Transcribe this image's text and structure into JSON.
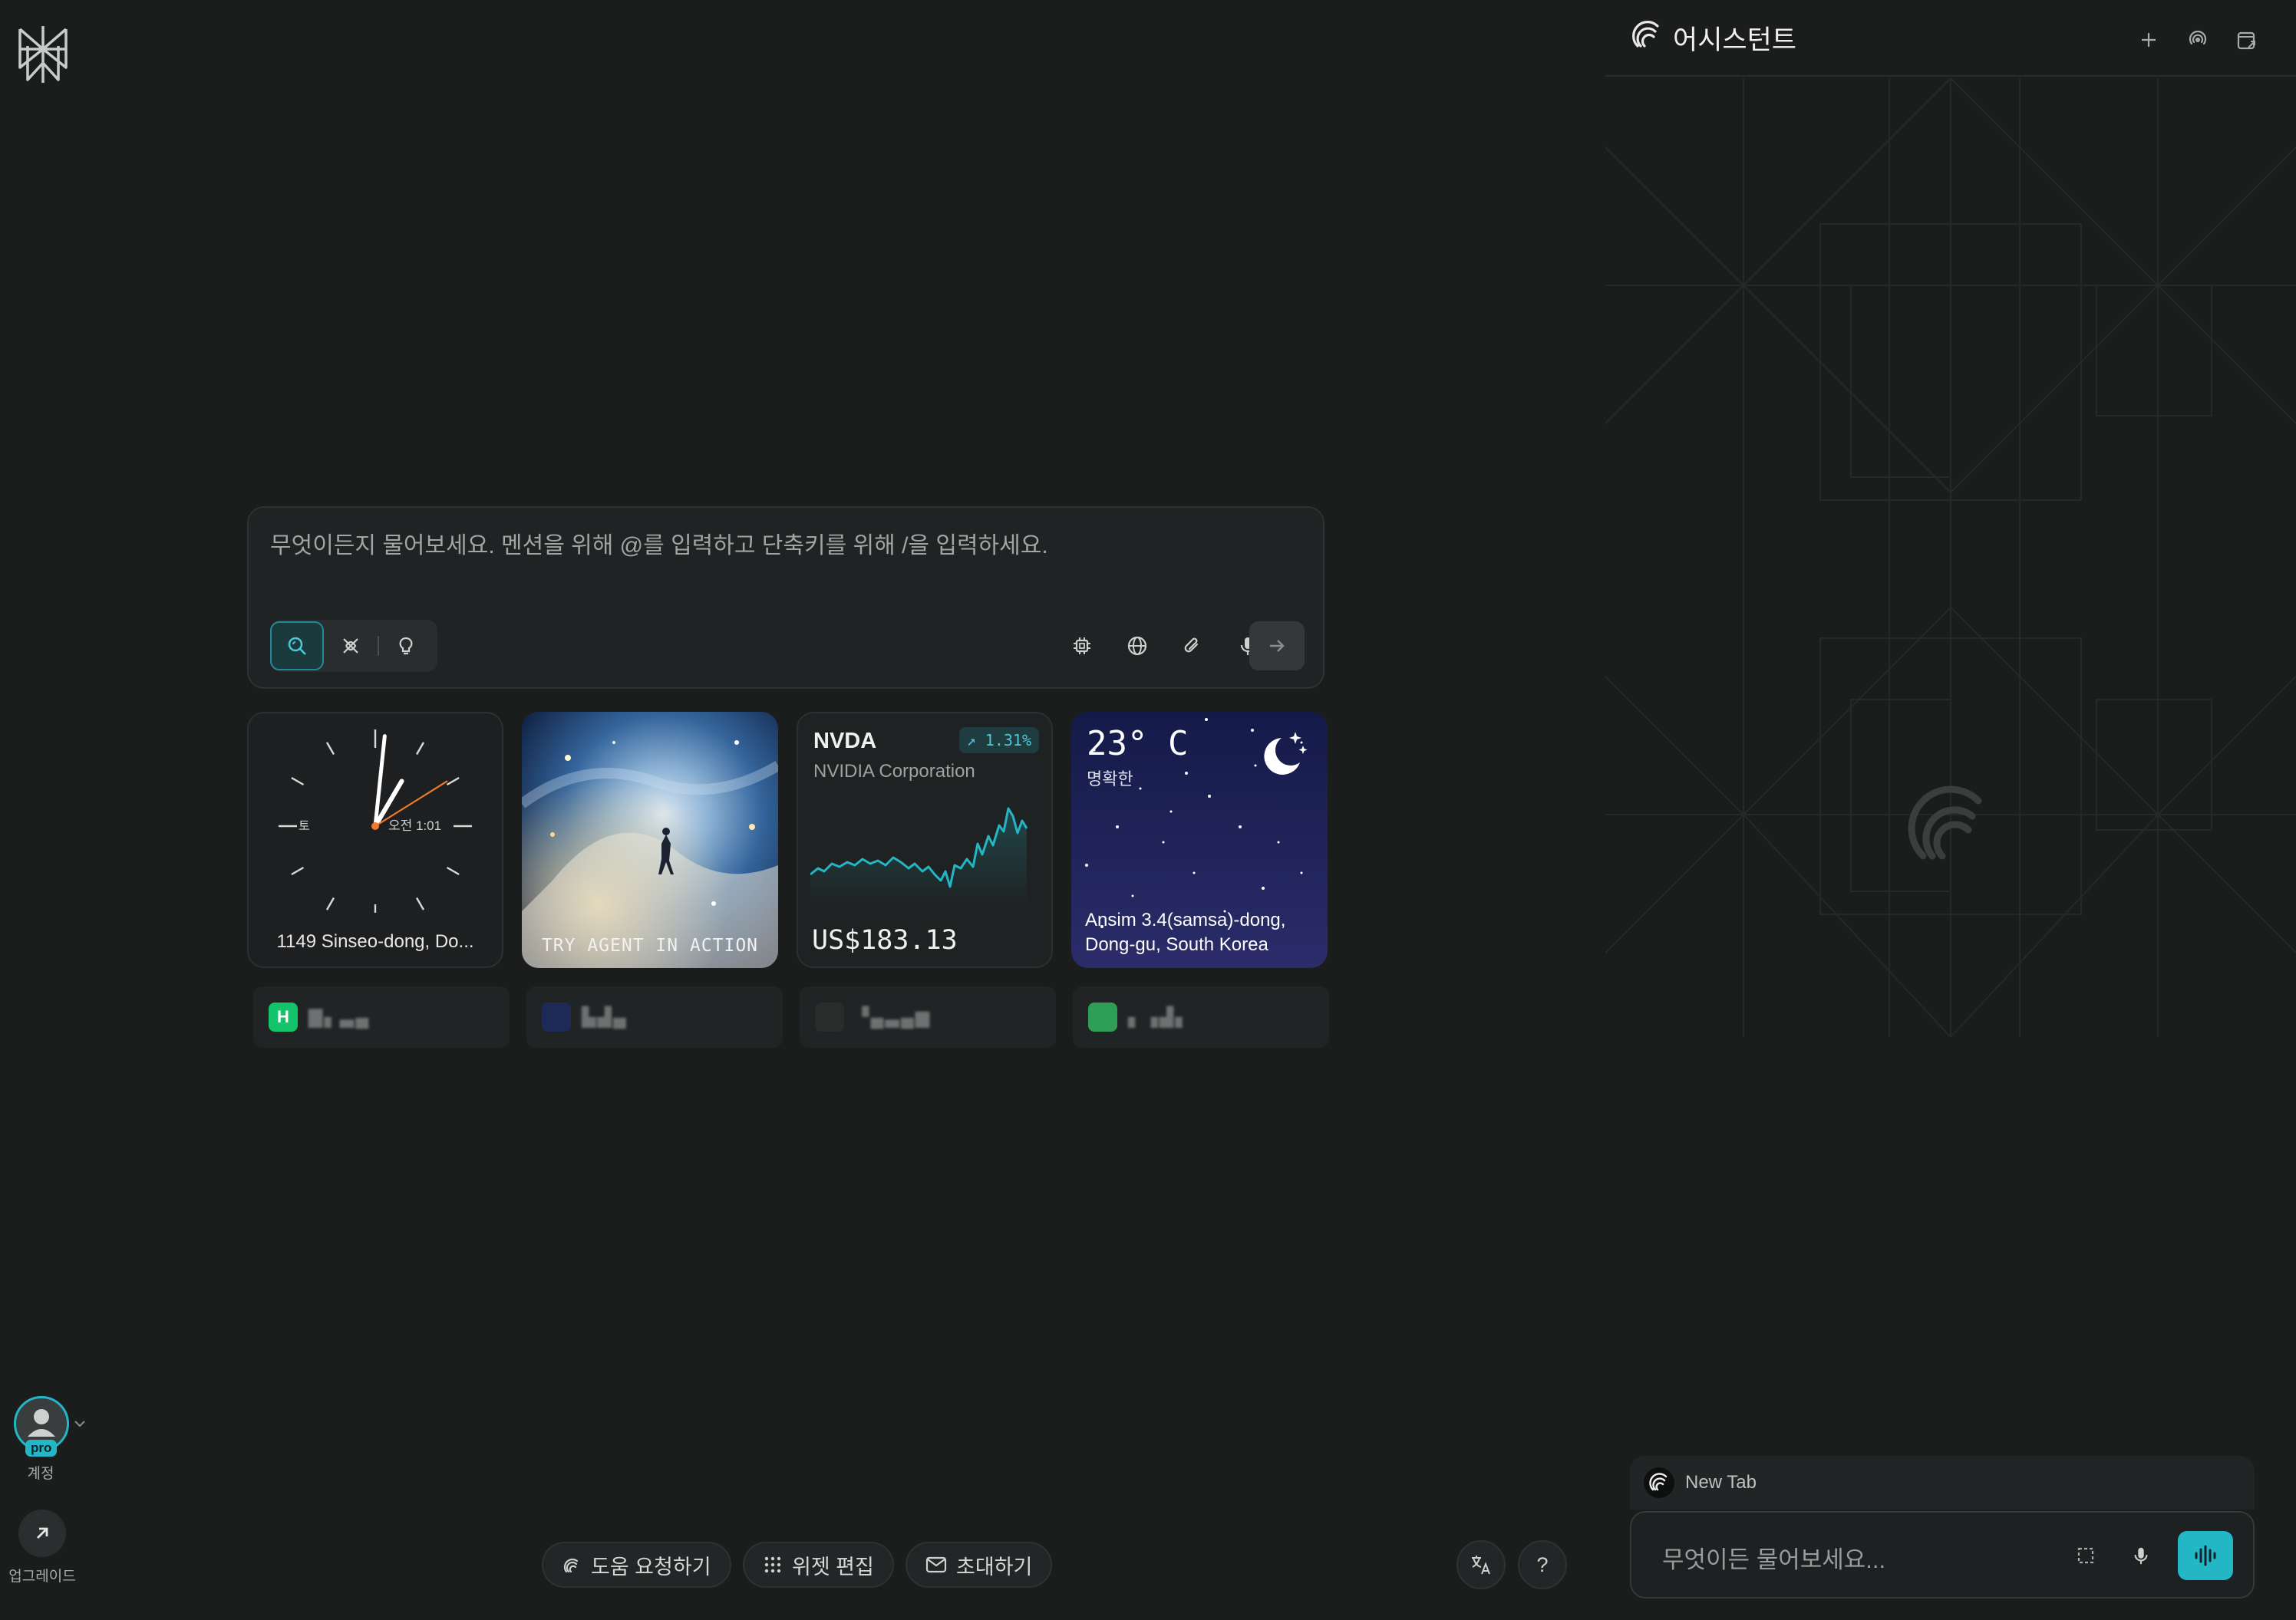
{
  "prompt": {
    "placeholder": "무엇이든지 물어보세요. 멘션을 위해 @를 입력하고 단축키를 위해 /을 입력하세요.",
    "modes": [
      "search-icon",
      "research-icon",
      "lightbulb-icon"
    ],
    "tools": [
      "chip-icon",
      "globe-icon",
      "paperclip-icon",
      "microphone-icon"
    ]
  },
  "rail": {
    "account_label": "계정",
    "pro_badge": "pro",
    "upgrade_label": "업그레이드"
  },
  "widgets": {
    "clock": {
      "day": "토",
      "time": "오전 1:01",
      "location": "1149 Sinseo-dong, Do..."
    },
    "agent": {
      "label": "TRY AGENT IN ACTION"
    },
    "stock": {
      "ticker": "NVDA",
      "name": "NVIDIA Corporation",
      "change": "1.31%",
      "price": "US$183.13",
      "line_color": "#23b7c6"
    },
    "weather": {
      "temp": "23° C",
      "condition": "명확한",
      "location": "Ansim 3.4(samsa)-dong, Dong-gu, South Korea"
    }
  },
  "shortcuts": [
    {
      "icon_color": "#13c46a",
      "letter": "H"
    },
    {
      "icon_color": "#1d2a55",
      "letter": ""
    },
    {
      "icon_color": "#2a2c2c",
      "letter": ""
    },
    {
      "icon_color": "#2e9e57",
      "letter": ""
    }
  ],
  "bottom_bar": {
    "help": "도움 요청하기",
    "edit_widgets": "위젯 편집",
    "invite": "초대하기",
    "question": "?"
  },
  "assistant": {
    "title": "어시스턴트",
    "tab_label": "New Tab",
    "input_placeholder": "무엇이든 물어보세요...",
    "accent": "#23b7c6"
  }
}
